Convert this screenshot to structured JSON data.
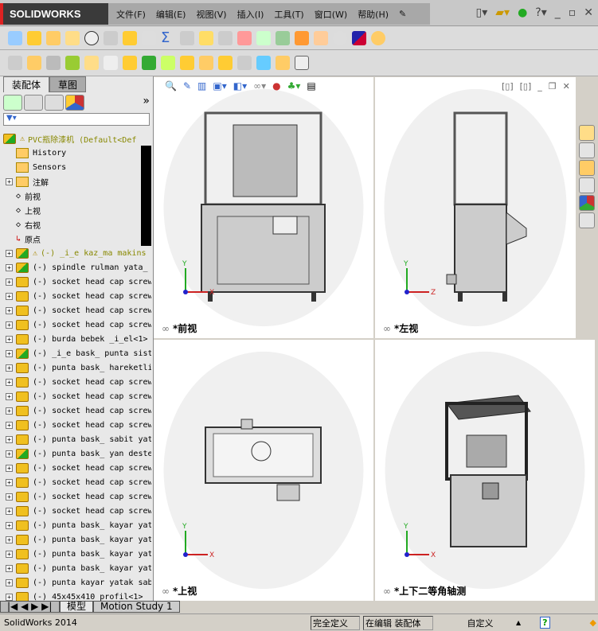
{
  "app": {
    "logo": "SOLIDWORKS"
  },
  "menu": [
    "文件(F)",
    "编辑(E)",
    "视图(V)",
    "插入(I)",
    "工具(T)",
    "窗口(W)",
    "帮助(H)"
  ],
  "panel_tabs": [
    "装配体",
    "草图"
  ],
  "tree": {
    "root": "PVC瓶除漆机  (Default<Def",
    "fixed": [
      "History",
      "Sensors",
      "注解",
      "前视",
      "上视",
      "右视",
      "原点"
    ],
    "components": [
      {
        "label": "(-) _i_e kaz_ma makins",
        "warn": true,
        "green": true
      },
      {
        "label": "(-) spindle rulman yata_",
        "green": true
      },
      {
        "label": "(-) socket head cap screw"
      },
      {
        "label": "(-) socket head cap screw"
      },
      {
        "label": "(-) socket head cap screw"
      },
      {
        "label": "(-) socket head cap screw"
      },
      {
        "label": "(-) burda bebek _i_el<1>"
      },
      {
        "label": "(-) _i_e bask_ punta sist",
        "green": true
      },
      {
        "label": "(-) punta bask_ hareketli"
      },
      {
        "label": "(-) socket head cap screw"
      },
      {
        "label": "(-) socket head cap screw"
      },
      {
        "label": "(-) socket head cap screw"
      },
      {
        "label": "(-) socket head cap screw"
      },
      {
        "label": "(-) punta bask_ sabit yat"
      },
      {
        "label": "(-) punta bask_ yan deste",
        "green": true
      },
      {
        "label": "(-) socket head cap screw"
      },
      {
        "label": "(-) socket head cap screw"
      },
      {
        "label": "(-) socket head cap screw"
      },
      {
        "label": "(-) socket head cap screw"
      },
      {
        "label": "(-) punta bask_ kayar yat"
      },
      {
        "label": "(-) punta bask_ kayar yat"
      },
      {
        "label": "(-) punta bask_ kayar yat"
      },
      {
        "label": "(-) punta bask_ kayar yat"
      },
      {
        "label": "(-) punta kayar yatak sab"
      },
      {
        "label": "(-) 45x45x410 profil<1>"
      }
    ]
  },
  "bottom_tabs": [
    "模型",
    "Motion Study 1"
  ],
  "views": {
    "front": "*前视",
    "left": "*左视",
    "top": "*上视",
    "iso": "*上下二等角轴测"
  },
  "axes": {
    "x": "X",
    "y": "Y",
    "z": "Z"
  },
  "status": {
    "app": "SolidWorks 2014",
    "defined": "完全定义",
    "editing": "在编辑 装配体",
    "units": "自定义"
  }
}
